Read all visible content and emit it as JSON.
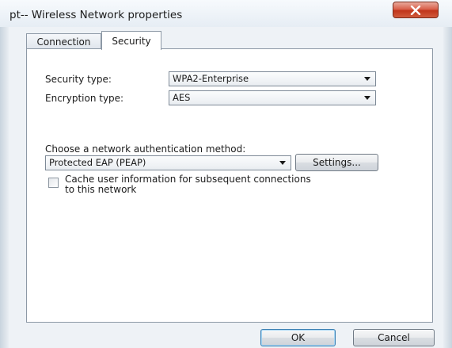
{
  "window": {
    "title": "pt-- Wireless Network properties",
    "close_icon": "close-icon"
  },
  "tabs": [
    {
      "label": "Connection",
      "selected": false
    },
    {
      "label": "Security",
      "selected": true
    }
  ],
  "security": {
    "security_type_label": "Security type:",
    "security_type_value": "WPA2-Enterprise",
    "encryption_type_label": "Encryption type:",
    "encryption_type_value": "AES",
    "auth_method_label": "Choose a network authentication method:",
    "auth_method_value": "Protected EAP (PEAP)",
    "settings_label": "Settings...",
    "cache_line1": "Cache user information for subsequent connections",
    "cache_line2": "to this network",
    "cache_checked": false
  },
  "footer": {
    "ok_label": "OK",
    "cancel_label": "Cancel"
  },
  "colors": {
    "close_button": "#c9452a",
    "panel_border": "#8d99a6",
    "window_bg": "#eef2f6"
  }
}
